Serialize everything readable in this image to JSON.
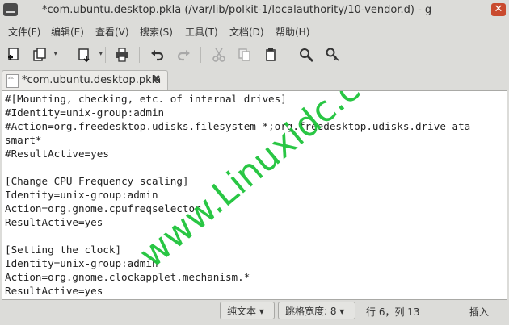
{
  "window": {
    "title": "*com.ubuntu.desktop.pkla (/var/lib/polkit-1/localauthority/10-vendor.d) - g",
    "close_glyph": "✕"
  },
  "menu": {
    "file": "文件(F)",
    "edit": "编辑(E)",
    "view": "查看(V)",
    "search": "搜索(S)",
    "tools": "工具(T)",
    "documents": "文档(D)",
    "help": "帮助(H)"
  },
  "toolbar_icons": [
    "new-document-icon",
    "open-icon",
    "save-icon",
    "print-icon",
    "undo-icon",
    "redo-icon",
    "cut-icon",
    "copy-icon",
    "paste-icon",
    "find-icon",
    "replace-icon"
  ],
  "tab": {
    "label": "*com.ubuntu.desktop.pkla",
    "close_glyph": "✖"
  },
  "editor": {
    "lines": [
      "#[Mounting, checking, etc. of internal drives]",
      "#Identity=unix-group:admin",
      "#Action=org.freedesktop.udisks.filesystem-*;org.freedesktop.udisks.drive-ata-",
      "smart*",
      "#ResultActive=yes",
      "",
      "[Change CPU ",
      "Frequency scaling]",
      "Identity=unix-group:admin",
      "Action=org.gnome.cpufreqselector",
      "ResultActive=yes",
      "",
      "[Setting the clock]",
      "Identity=unix-group:admin",
      "Action=org.gnome.clockapplet.mechanism.*",
      "ResultActive=yes"
    ],
    "watermark": "www.Linuxidc.com"
  },
  "status": {
    "language": "纯文本 ▾",
    "tab_width": "跳格宽度: 8 ▾",
    "position": "行 6，列 13",
    "mode": "插入"
  },
  "colors": {
    "chrome": "#dcdcd9",
    "editor_bg": "#ffffff",
    "watermark": "#1ec43a",
    "close_button": "#c94a2e"
  }
}
